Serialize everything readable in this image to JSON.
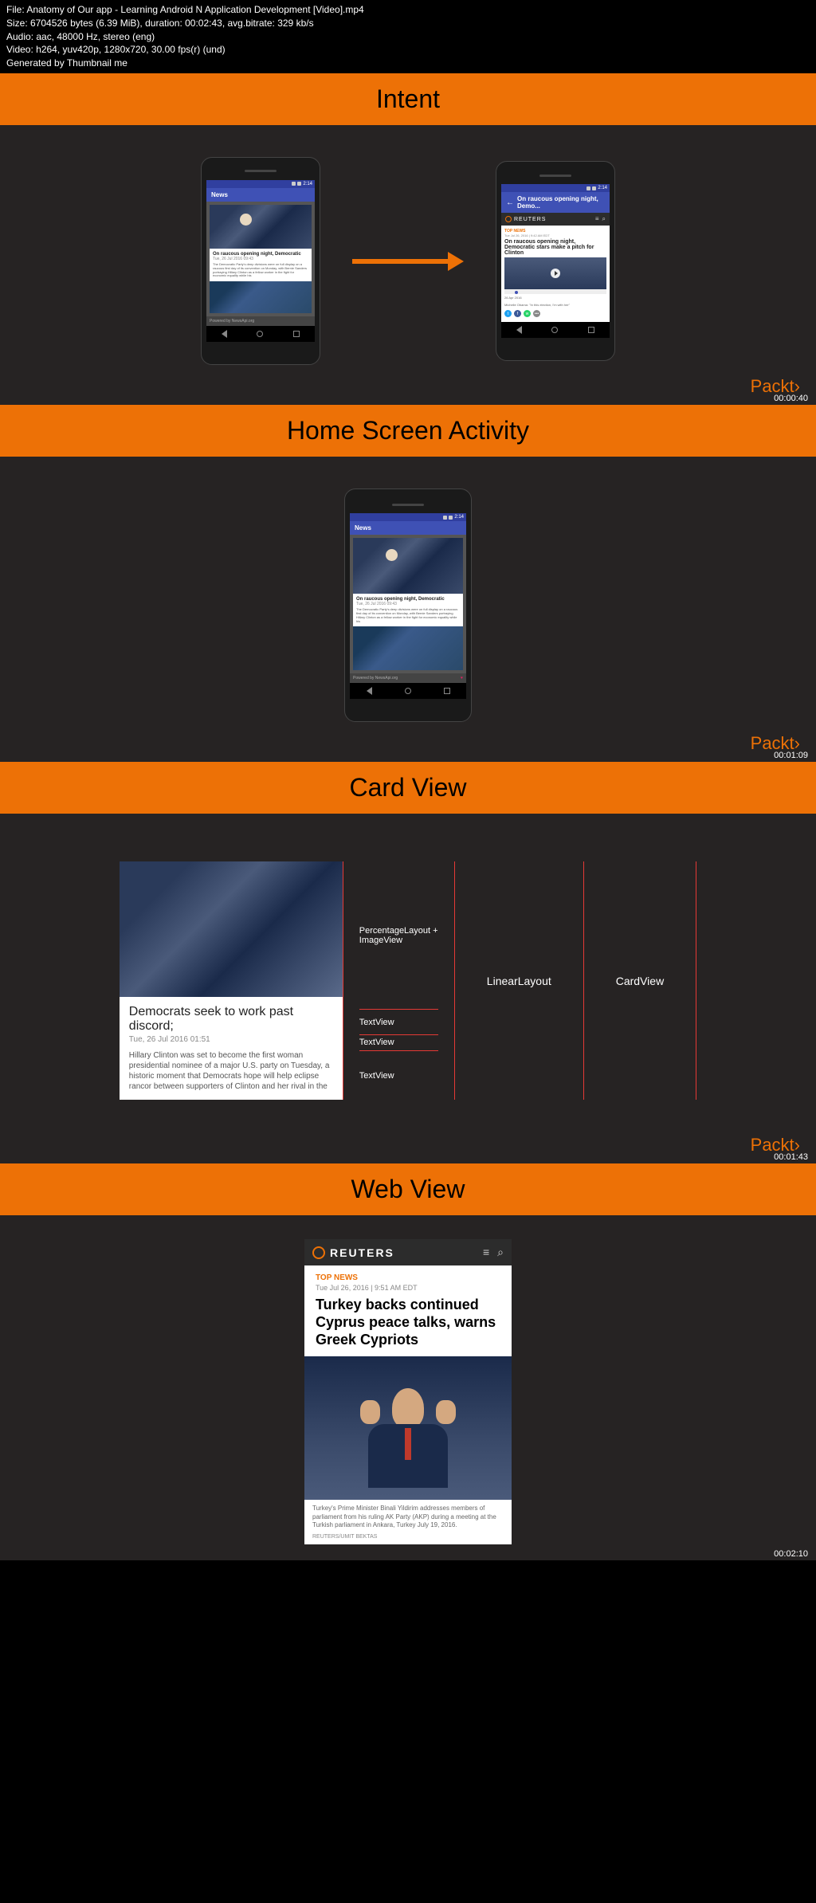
{
  "metadata": {
    "file": "File: Anatomy of Our app - Learning Android N Application Development [Video].mp4",
    "size": "Size: 6704526 bytes (6.39 MiB), duration: 00:02:43, avg.bitrate: 329 kb/s",
    "audio": "Audio: aac, 48000 Hz, stereo (eng)",
    "video": "Video: h264, yuv420p, 1280x720, 30.00 fps(r) (und)",
    "generated": "Generated by Thumbnail me"
  },
  "sections": {
    "intent": "Intent",
    "home": "Home Screen Activity",
    "card": "Card View",
    "web": "Web View"
  },
  "brand": "Packt",
  "timestamps": [
    "00:00:40",
    "00:01:09",
    "00:01:43",
    "00:02:10"
  ],
  "phone": {
    "status_time": "2:14",
    "app_title": "News",
    "detail_title": "On raucous opening night, Demo...",
    "news_title": "On raucous opening night, Democratic",
    "news_date": "Tue, 26 Jul 2016 09:43",
    "news_desc": "The Democratic Party's deep divisions were on full display on a raucous first day of its convention on Monday, with Bernie Sanders portraying Hillary Clinton as a fellow worker in the fight for economic equality while his",
    "footer": "Powered by NewsApi.org"
  },
  "reuters": {
    "brand": "REUTERS",
    "top_news": "TOP NEWS",
    "date": "Tue Jul 26, 2016 | 9:42 AM EDT",
    "headline": "On raucous opening night, Democratic stars make a pitch for Clinton",
    "caption_date": "26 Apr 2016",
    "caption": "Michelle Obama: \"In this election, I'm with her\"",
    "more": "•••"
  },
  "card_diagram": {
    "title": "Democrats seek to work past discord;",
    "date": "Tue, 26 Jul 2016 01:51",
    "desc": "Hillary Clinton was set to become the first woman presidential nominee of a major U.S. party on Tuesday, a historic moment that Democrats hope will help eclipse rancor between supporters of Clinton and her rival in the",
    "labels": {
      "percentage": "PercentageLayout + ImageView",
      "textview": "TextView",
      "linear": "LinearLayout",
      "cardview": "CardView"
    }
  },
  "webview": {
    "brand": "REUTERS",
    "top_news": "TOP NEWS",
    "date": "Tue Jul 26, 2016 | 9:51 AM EDT",
    "headline": "Turkey backs continued Cyprus peace talks, warns Greek Cypriots",
    "caption": "Turkey's Prime Minister Binali Yildirim addresses members of parliament from his ruling AK Party (AKP) during a meeting at the Turkish parliament in Ankara, Turkey July 19, 2016.",
    "credit": "REUTERS/UMIT BEKTAS"
  }
}
